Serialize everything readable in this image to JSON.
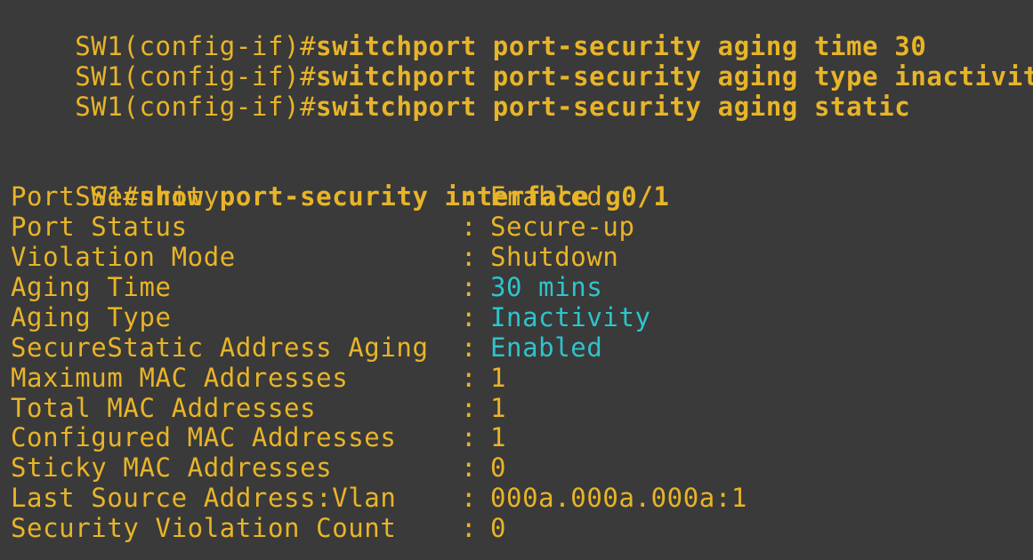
{
  "colors": {
    "background": "#3a3a3a",
    "text": "#e8b428",
    "highlight": "#2ec4cc"
  },
  "config_lines": [
    {
      "prompt": "SW1(config-if)#",
      "command": "switchport port-security aging time 30"
    },
    {
      "prompt": "SW1(config-if)#",
      "command": "switchport port-security aging type inactivity"
    },
    {
      "prompt": "SW1(config-if)#",
      "command": "switchport port-security aging static"
    }
  ],
  "show_line": {
    "prompt": "SW1#",
    "command": "show port-security interface g0/1"
  },
  "separator": ":",
  "rows": [
    {
      "label": "Port Security",
      "value": "Enabled",
      "highlight": false
    },
    {
      "label": "Port Status",
      "value": "Secure-up",
      "highlight": false
    },
    {
      "label": "Violation Mode",
      "value": "Shutdown",
      "highlight": false
    },
    {
      "label": "Aging Time",
      "value": "30 mins",
      "highlight": true
    },
    {
      "label": "Aging Type",
      "value": "Inactivity",
      "highlight": true
    },
    {
      "label": "SecureStatic Address Aging",
      "value": "Enabled",
      "highlight": true
    },
    {
      "label": "Maximum MAC Addresses",
      "value": "1",
      "highlight": false
    },
    {
      "label": "Total MAC Addresses",
      "value": "1",
      "highlight": false
    },
    {
      "label": "Configured MAC Addresses",
      "value": "1",
      "highlight": false
    },
    {
      "label": "Sticky MAC Addresses",
      "value": "0",
      "highlight": false
    },
    {
      "label": "Last Source Address:Vlan",
      "value": "000a.000a.000a:1",
      "highlight": false
    },
    {
      "label": "Security Violation Count",
      "value": "0",
      "highlight": false
    }
  ]
}
